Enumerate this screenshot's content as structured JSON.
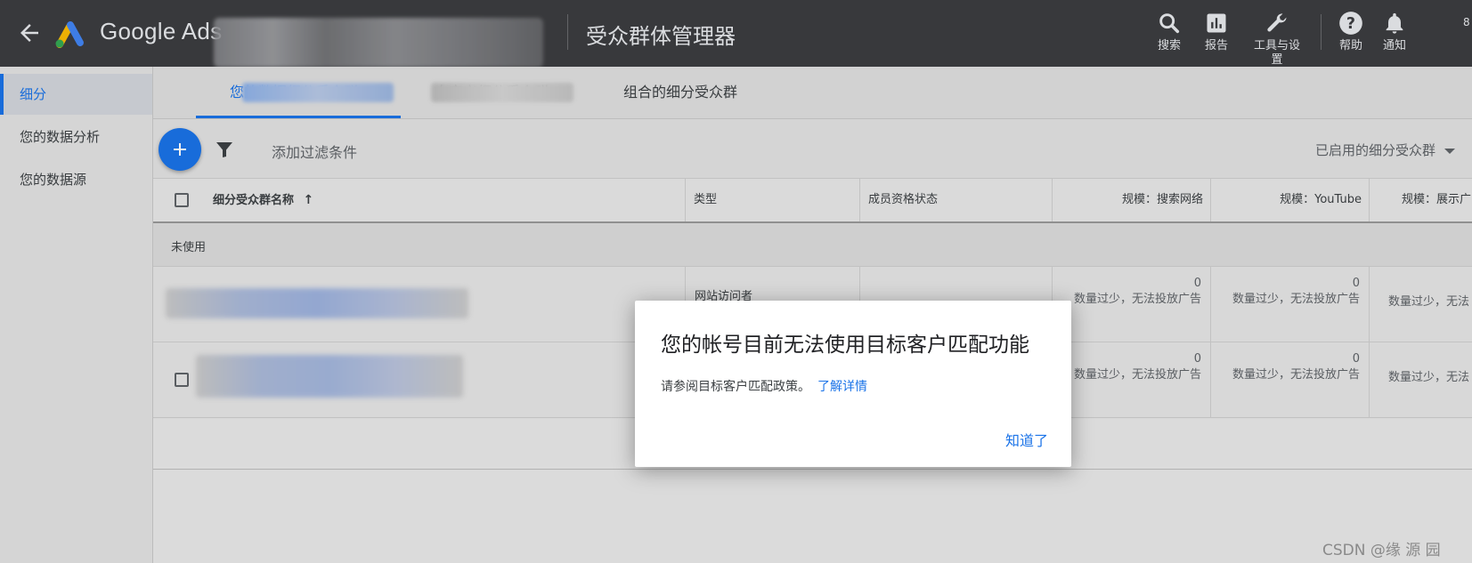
{
  "header": {
    "brand": "Google Ads",
    "page_title": "受众群体管理器",
    "tools": [
      {
        "icon": "search-icon",
        "label": "搜索"
      },
      {
        "icon": "report-icon",
        "label": "报告"
      },
      {
        "icon": "wrench-icon",
        "label": "工具与设置"
      },
      {
        "icon": "help-icon",
        "label": "帮助"
      },
      {
        "icon": "bell-icon",
        "label": "通知"
      }
    ],
    "avatar_edge": "8"
  },
  "sidebar": {
    "items": [
      {
        "label": "细分",
        "active": true
      },
      {
        "label": "您的数据分析",
        "active": false
      },
      {
        "label": "您的数据源",
        "active": false
      }
    ]
  },
  "tabs": [
    {
      "label": "您的数据细分受众群",
      "active": true
    },
    {
      "label": "自定义细分受众群",
      "active": false
    },
    {
      "label": "组合的细分受众群",
      "active": false
    }
  ],
  "toolbar": {
    "filter_label": "添加过滤条件",
    "status_dropdown": "已启用的细分受众群"
  },
  "table": {
    "columns": [
      "细分受众群名称",
      "类型",
      "成员资格状态",
      "规模：搜索网络",
      "规模：YouTube",
      "规模：展示广"
    ],
    "section_label": "未使用",
    "rows": [
      {
        "type": "网站访问者",
        "search_count": "0",
        "search_note": "数量过少，无法投放广告",
        "youtube_count": "0",
        "youtube_note": "数量过少，无法投放广告",
        "display_note": "数量过少，无法"
      },
      {
        "type": "",
        "search_count": "0",
        "search_note": "数量过少，无法投放广告",
        "youtube_count": "0",
        "youtube_note": "数量过少，无法投放广告",
        "display_note": "数量过少，无法"
      }
    ]
  },
  "dialog": {
    "title": "您的帐号目前无法使用目标客户匹配功能",
    "body": "请参阅目标客户匹配政策。",
    "link": "了解详情",
    "button": "知道了"
  },
  "watermark": "CSDN @缘 源 园",
  "colors": {
    "header_bg": "#3c3d40",
    "accent": "#1a73e8",
    "sidebar_bg": "#e3e3e3"
  }
}
